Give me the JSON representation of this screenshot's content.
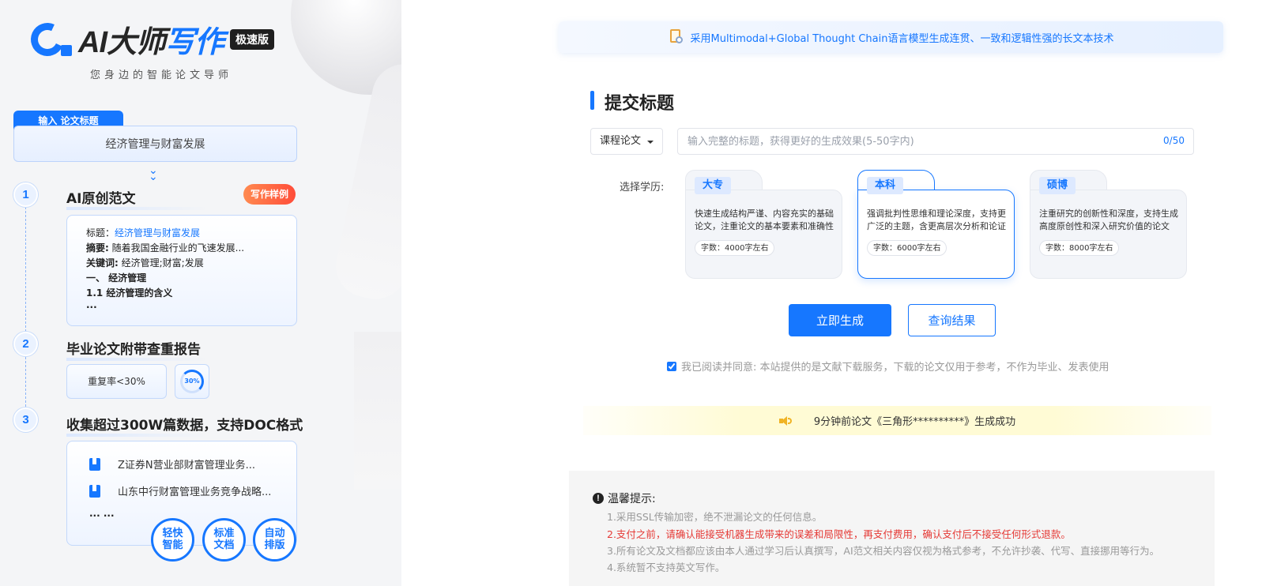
{
  "left": {
    "logo": {
      "text_plain": "AI大师",
      "text_accent": "写作",
      "badge": "极速版"
    },
    "slogan": "您身边的智能论文导师",
    "input_tag": "输入 论文标题",
    "input_value": "经济管理与财富发展",
    "steps": [
      {
        "num": "1",
        "title": "AI原创范文"
      },
      {
        "num": "2",
        "title": "毕业论文附带查重报告"
      },
      {
        "num": "3",
        "title": "收集超过300W篇数据，支持DOC格式"
      }
    ],
    "sample_tag": "写作样例",
    "sample": {
      "title_label": "标题：",
      "title_value": "经济管理与财富发展",
      "abstract_label": "摘要:",
      "abstract_value": " 随着我国金融行业的飞速发展...",
      "keywords_label": "关键词:",
      "keywords_value": " 经济管理;财富;发展",
      "h1": "一、 经济管理",
      "h2": "1.1 经济管理的含义",
      "more": "..."
    },
    "report": {
      "label": "重复率<30%",
      "ring_text": "30%",
      "ring_value": 0.3
    },
    "docs": [
      "Z证券N营业部财富管理业务...",
      "山东中行财富管理业务竞争战略..."
    ],
    "docs_more": "... ...",
    "features": [
      {
        "line1": "轻快",
        "line2": "智能"
      },
      {
        "line1": "标准",
        "line2": "文档"
      },
      {
        "line1": "自动",
        "line2": "排版"
      }
    ]
  },
  "banner": "采用Multimodal+Global Thought Chain语言模型生成连贯、一致和逻辑性强的长文本技术",
  "form": {
    "section_title": "提交标题",
    "type_select": "课程论文",
    "title_placeholder": "输入完整的标题，获得更好的生成效果(5-50字内)",
    "char_count": "0/50",
    "edu_label": "选择学历:",
    "edu_options": [
      {
        "level": "大专",
        "desc": "快速生成结构严谨、内容充实的基础论文，注重论文的基本要素和准确性",
        "words": "字数：4000字左右",
        "active": false
      },
      {
        "level": "本科",
        "desc": "强调批判性思维和理论深度，支持更广泛的主题，含更高层次分析和论证",
        "words": "字数：6000字左右",
        "active": true
      },
      {
        "level": "硕博",
        "desc": "注重研究的创新性和深度，支持生成高度原创性和深入研究价值的论文",
        "words": "字数：8000字左右",
        "active": false
      }
    ],
    "generate_button": "立即生成",
    "query_button": "查询结果",
    "agree_text": "我已阅读并同意: 本站提供的是文献下载服务，下载的论文仅用于参考，不作为毕业、发表使用",
    "agree_checked": true
  },
  "notice": "9分钟前论文《三角形**********》生成成功",
  "tips": {
    "title": "温馨提示:",
    "items": [
      "1.采用SSL传输加密，绝不泄漏论文的任何信息。",
      "2.支付之前，请确认能接受机器生成带来的误差和局限性，再支付费用，确认支付后不接受任何形式退款。",
      "3.所有论文及文档都应该由本人通过学习后认真撰写，AI范文相关内容仅视为格式参考，不允许抄袭、代写、直接挪用等行为。",
      "4.系统暂不支持英文写作。"
    ]
  },
  "colors": {
    "accent": "#1677ff",
    "warning": "#e53935",
    "notice_bg": "#fffbd5"
  }
}
